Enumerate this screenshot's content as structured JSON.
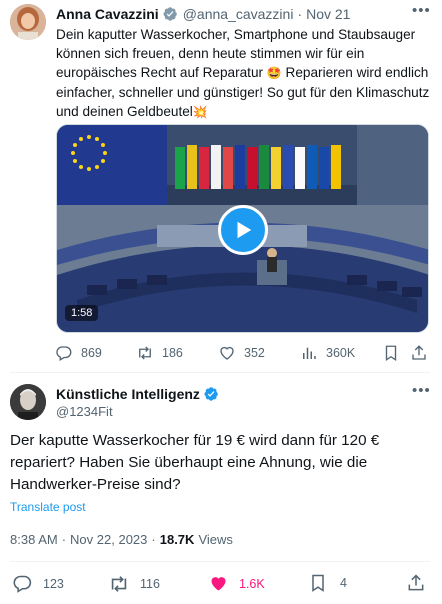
{
  "tweet1": {
    "author_name": "Anna Cavazzini",
    "handle": "@anna_cavazzini",
    "separator": "·",
    "date": "Nov 21",
    "text_part1": "Dein kaputter Wasserkocher, Smartphone und Staubsauger können sich freuen, denn heute stimmen wir für ein europäisches Recht auf Reparatur",
    "emoji1": "🤩",
    "text_part2": " Reparieren wird endlich einfacher, schneller und günstiger! So gut für den Klimaschutz und deinen Geldbeutel",
    "emoji2": "💥",
    "video_duration": "1:58",
    "replies": "869",
    "retweets": "186",
    "likes": "352",
    "views": "360K"
  },
  "tweet2": {
    "author_name": "Künstliche Intelligenz",
    "handle": "@1234Fit",
    "text": "Der kaputte Wasserkocher für 19 € wird dann für 120 € repariert? Haben Sie überhaupt eine Ahnung, wie die Handwerker-Preise sind?",
    "translate_label": "Translate post",
    "time": "8:38 AM",
    "separator": "·",
    "date": "Nov 22, 2023",
    "views_count": "18.7K",
    "views_label": "Views",
    "replies": "123",
    "retweets": "116",
    "likes": "1.6K",
    "bookmarks": "4"
  },
  "colors": {
    "accent": "#1d9bf0",
    "like_active": "#f91880",
    "muted": "#536471",
    "text": "#0f1419"
  },
  "icons": [
    "verified-badge-icon",
    "more-icon",
    "play-icon",
    "reply-icon",
    "retweet-icon",
    "like-icon",
    "views-icon",
    "bookmark-icon",
    "share-icon"
  ]
}
